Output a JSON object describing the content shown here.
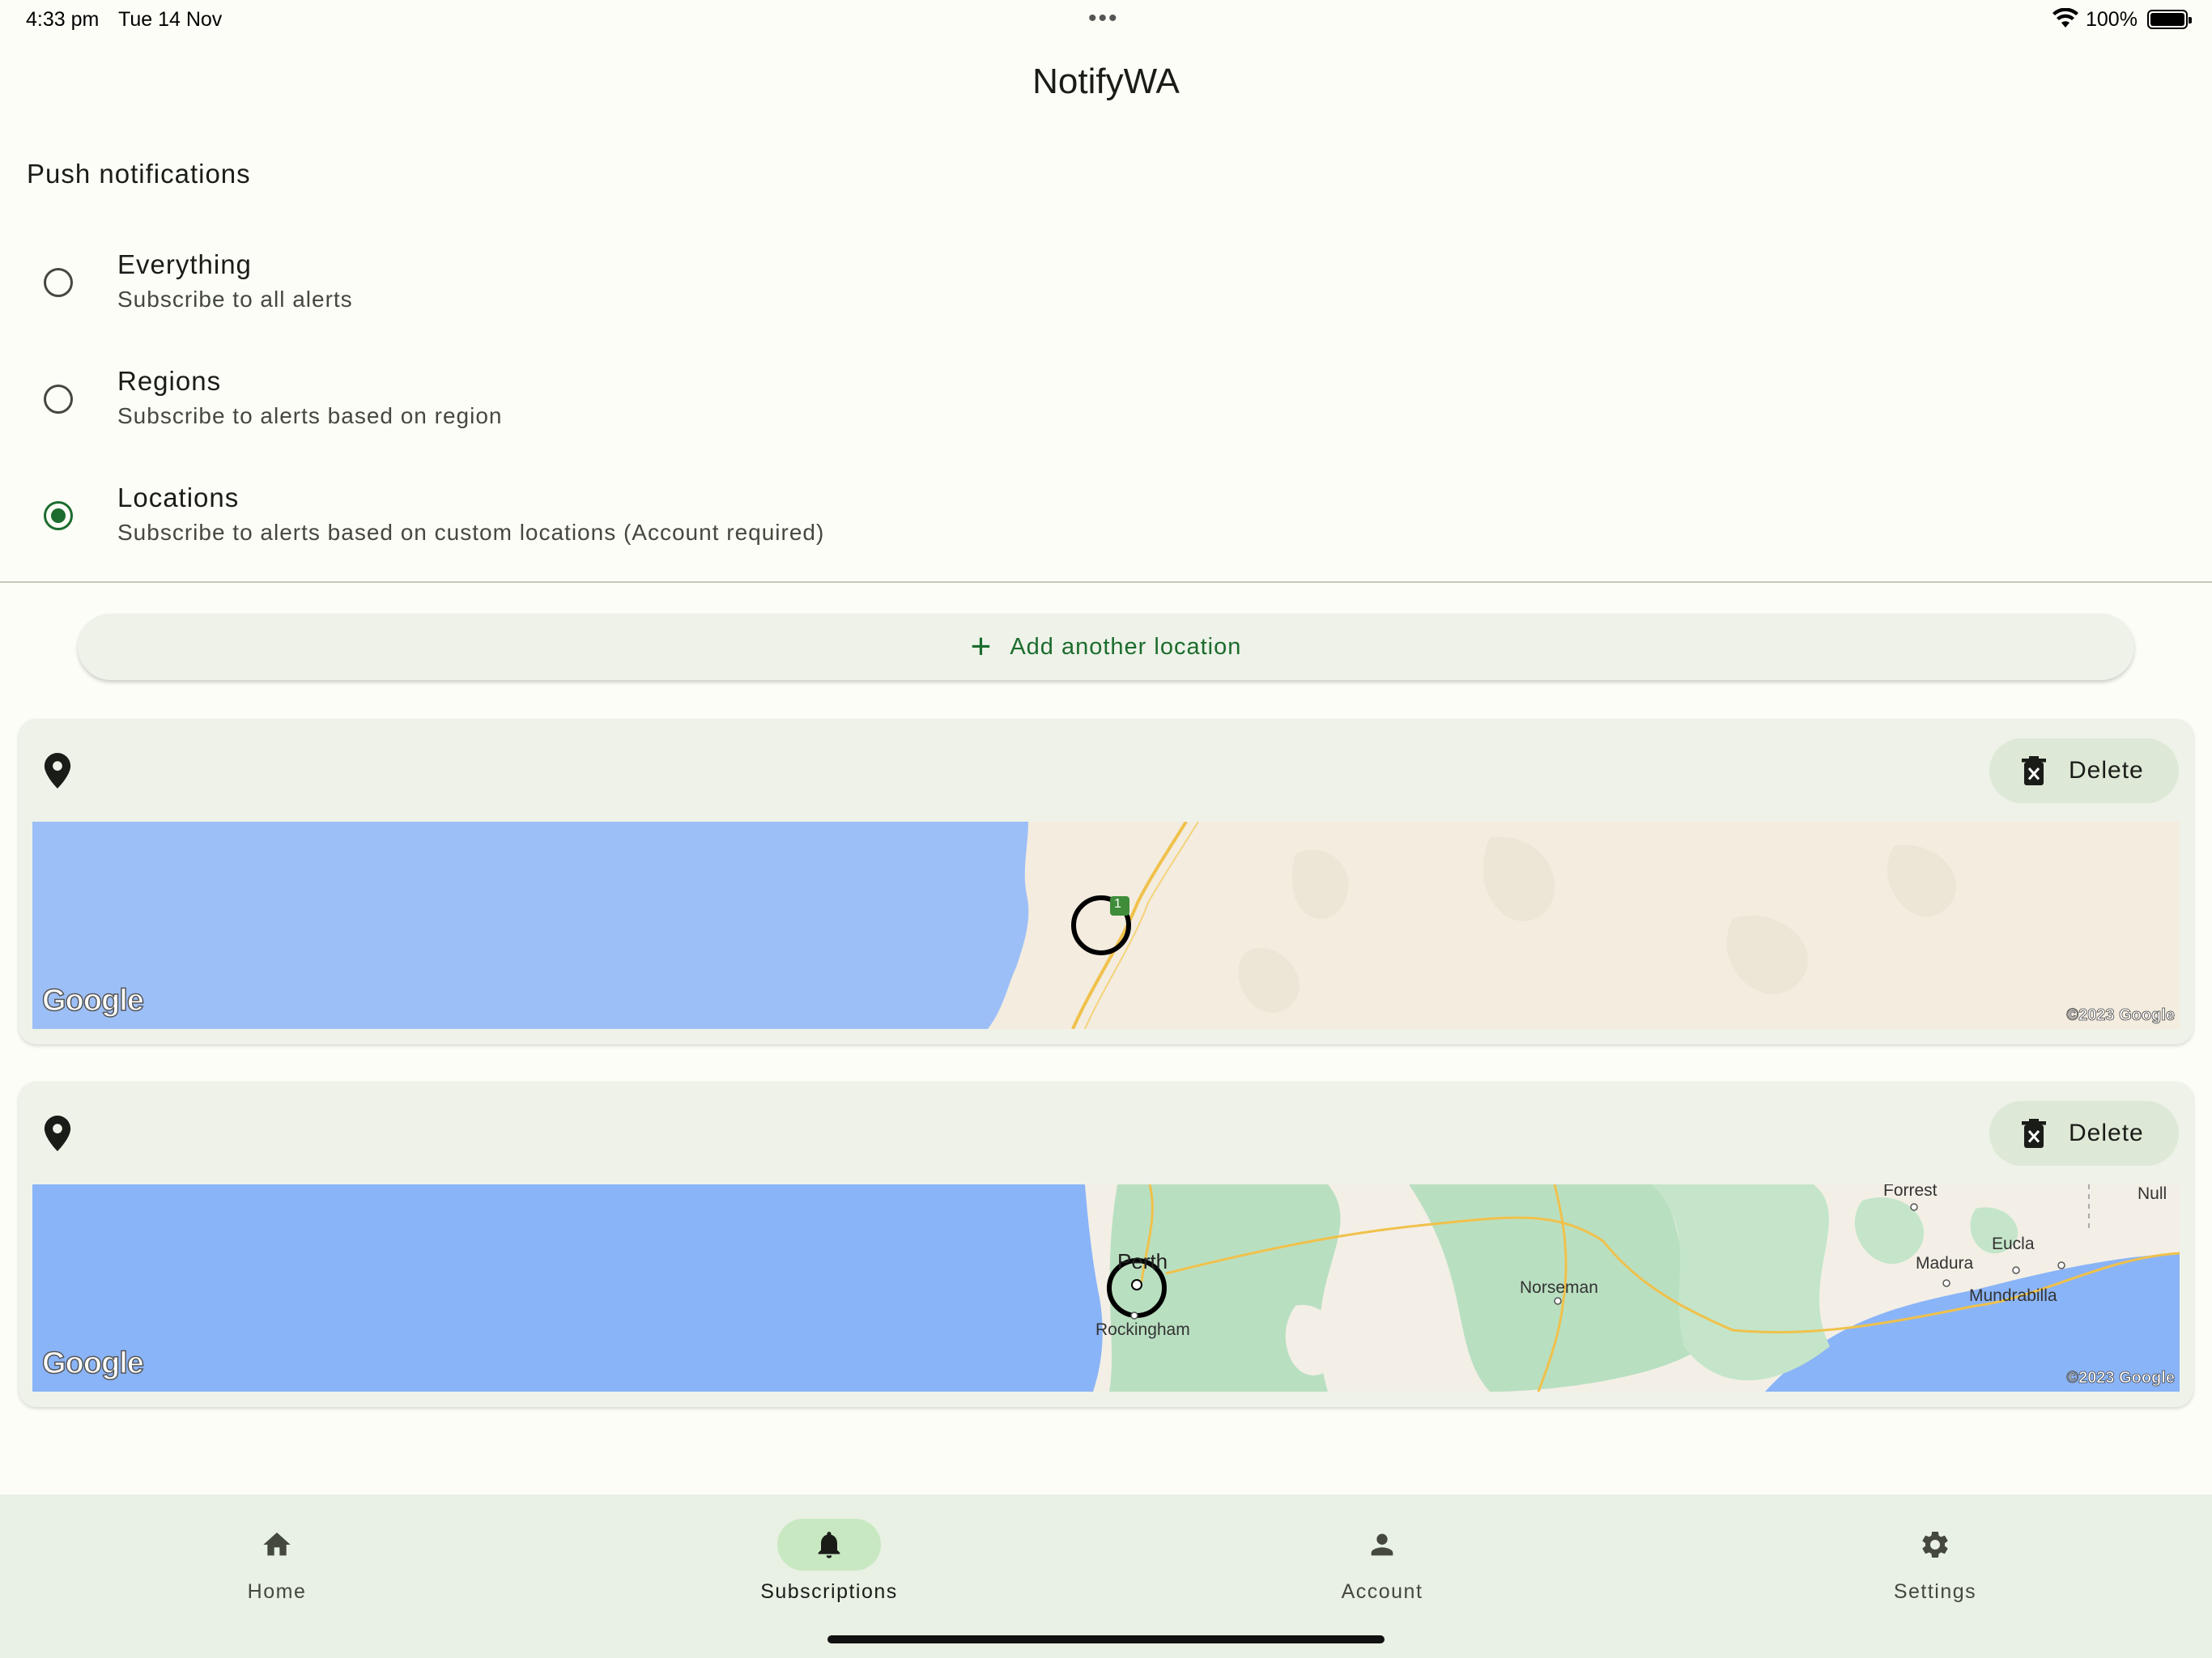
{
  "status_bar": {
    "time": "4:33 pm",
    "date": "Tue 14 Nov",
    "battery": "100%",
    "dots": "•••"
  },
  "app": {
    "title": "NotifyWA"
  },
  "push_notifications": {
    "heading": "Push notifications",
    "options": [
      {
        "title": "Everything",
        "subtitle": "Subscribe to all alerts",
        "selected": false
      },
      {
        "title": "Regions",
        "subtitle": "Subscribe to alerts based on region",
        "selected": false
      },
      {
        "title": "Locations",
        "subtitle": "Subscribe to alerts based on custom locations (Account required)",
        "selected": true
      }
    ]
  },
  "add_location": {
    "label": "Add another location",
    "icon": "plus-icon"
  },
  "locations": [
    {
      "delete_label": "Delete",
      "map": {
        "attribution": "Google",
        "copyright": "©2023 Google",
        "road_marker": "1"
      }
    },
    {
      "delete_label": "Delete",
      "map": {
        "attribution": "Google",
        "copyright": "©2023 Google",
        "labels": {
          "perth": "Perth",
          "rockingham": "Rockingham",
          "norseman": "Norseman",
          "forrest": "Forrest",
          "madura": "Madura",
          "eucla": "Eucla",
          "mundrabilla": "Mundrabilla",
          "nullarbor": "Null"
        }
      }
    }
  ],
  "bottom_nav": {
    "items": [
      {
        "label": "Home",
        "icon": "home-icon",
        "active": false
      },
      {
        "label": "Subscriptions",
        "icon": "bell-icon",
        "active": true
      },
      {
        "label": "Account",
        "icon": "person-icon",
        "active": false
      },
      {
        "label": "Settings",
        "icon": "gear-icon",
        "active": false
      }
    ]
  },
  "colors": {
    "primary": "#1b6c2e",
    "background": "#fcfdf6",
    "surface": "#eef2e8",
    "nav_active": "#c8e8c2",
    "water": "#9dbff7",
    "land": "#f2ebde"
  }
}
